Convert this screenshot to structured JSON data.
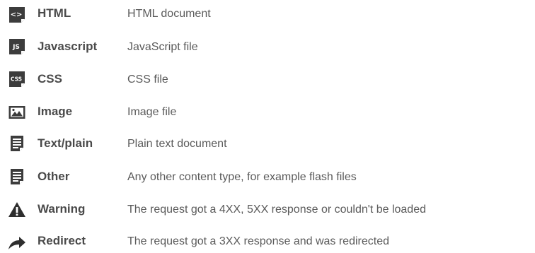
{
  "legend": {
    "items": [
      {
        "key": "html",
        "icon": "html-file-icon",
        "label": "HTML",
        "description": "HTML document",
        "badge": "<>"
      },
      {
        "key": "javascript",
        "icon": "js-file-icon",
        "label": "Javascript",
        "description": "JavaScript file",
        "badge": "JS"
      },
      {
        "key": "css",
        "icon": "css-file-icon",
        "label": "CSS",
        "description": "CSS file",
        "badge": "CSS"
      },
      {
        "key": "image",
        "icon": "image-file-icon",
        "label": "Image",
        "description": "Image file"
      },
      {
        "key": "text-plain",
        "icon": "text-file-icon",
        "label": "Text/plain",
        "description": "Plain text document"
      },
      {
        "key": "other",
        "icon": "other-file-icon",
        "label": "Other",
        "description": "Any other content type, for example flash files"
      },
      {
        "key": "warning",
        "icon": "warning-icon",
        "label": "Warning",
        "description": "The request got a 4XX, 5XX response or couldn't be loaded"
      },
      {
        "key": "redirect",
        "icon": "redirect-arrow-icon",
        "label": "Redirect",
        "description": "The request got a 3XX response and was redirected"
      }
    ]
  },
  "colors": {
    "icon": "#3c3c3c",
    "label": "#4a4a4a",
    "description": "#5a5a5a",
    "background": "#ffffff"
  }
}
